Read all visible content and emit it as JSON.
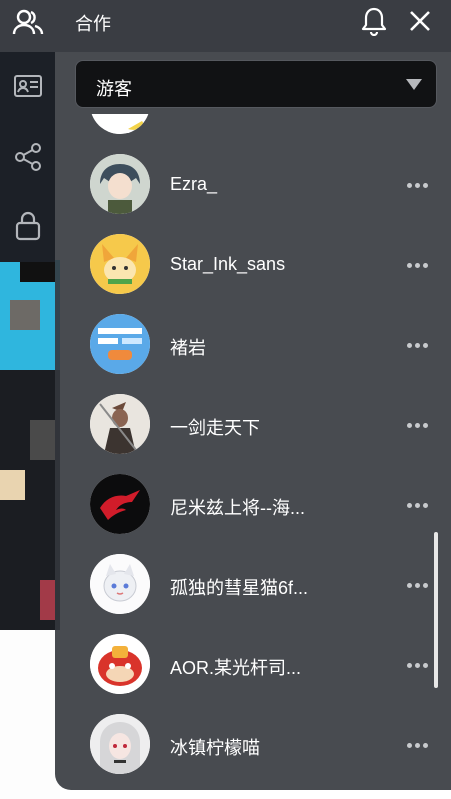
{
  "header": {
    "title": "合作"
  },
  "select": {
    "value": "游客"
  },
  "friends": [
    {
      "name": "",
      "avatar": "partial-avatar"
    },
    {
      "name": "Ezra_",
      "avatar": "boy-avatar"
    },
    {
      "name": "Star_Ink_sans",
      "avatar": "fox-avatar"
    },
    {
      "name": "褚岩",
      "avatar": "ui-screenshot-avatar"
    },
    {
      "name": "一剑走天下",
      "avatar": "warrior-avatar"
    },
    {
      "name": "尼米兹上将--海...",
      "avatar": "rog-logo-avatar"
    },
    {
      "name": "孤独的彗星猫6f...",
      "avatar": "white-cat-avatar"
    },
    {
      "name": "AOR.某光杆司...",
      "avatar": "red-lion-avatar"
    },
    {
      "name": "冰镇柠檬喵",
      "avatar": "anime-girl-avatar"
    }
  ],
  "colors": {
    "panel": "#34373d",
    "rail": "#1c2027",
    "header": "#3a3d43",
    "accent": "#ffffff"
  }
}
